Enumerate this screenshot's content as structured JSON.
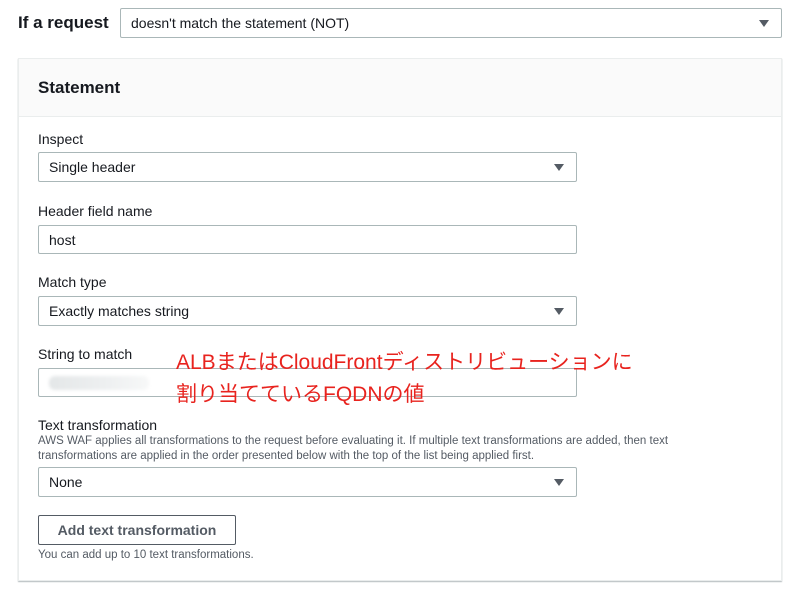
{
  "top": {
    "label": "If a request",
    "select_value": "doesn't match the statement (NOT)"
  },
  "statement": {
    "title": "Statement",
    "inspect": {
      "label": "Inspect",
      "value": "Single header"
    },
    "header_field": {
      "label": "Header field name",
      "value": "host"
    },
    "match_type": {
      "label": "Match type",
      "value": "Exactly matches string"
    },
    "string_to_match": {
      "label": "String to match",
      "value": ""
    },
    "text_transformation": {
      "label": "Text transformation",
      "description": "AWS WAF applies all transformations to the request before evaluating it. If multiple text transformations are added, then text transformations are applied in the order presented below with the top of the list being applied first.",
      "value": "None"
    },
    "add_button_label": "Add text transformation",
    "hint": "You can add up to 10 text transformations."
  },
  "annotation": {
    "line1": "ALBまたはCloudFrontディストリビューションに",
    "line2": "割り当てているFQDNの値",
    "color": "#e8231e"
  },
  "icons": {
    "caret": "caret-down-icon"
  }
}
